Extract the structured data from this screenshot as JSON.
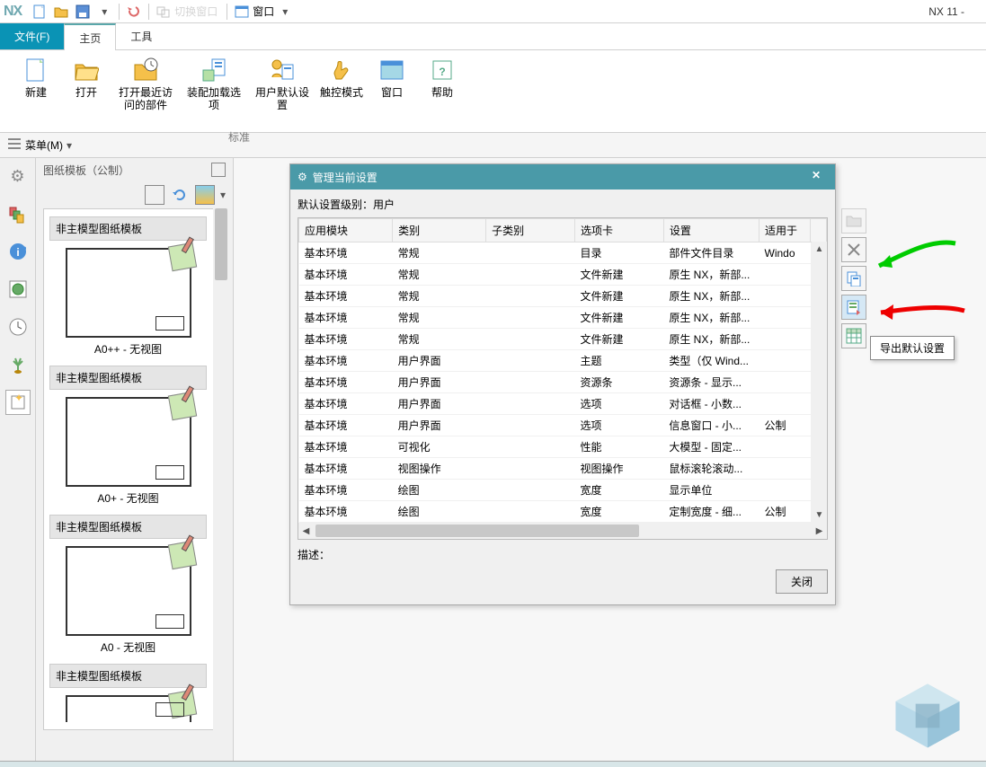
{
  "app": {
    "logo": "NX",
    "title": "NX 11 -"
  },
  "quickaccess": {
    "switch_window": "切换窗口",
    "window": "窗口"
  },
  "menu": {
    "file": "文件(F)",
    "home": "主页",
    "tools": "工具"
  },
  "ribbon": {
    "group_label": "标准",
    "new": "新建",
    "open": "打开",
    "open_recent": "打开最近访问的部件",
    "assy_load": "装配加载选项",
    "user_defaults": "用户默认设置",
    "touch_mode": "触控模式",
    "window": "窗口",
    "help": "帮助"
  },
  "menubar2": {
    "menu": "菜单(M)"
  },
  "template_panel": {
    "title": "图纸模板（公制）",
    "groups": [
      {
        "head": "非主模型图纸模板",
        "label": "A0++ - 无视图"
      },
      {
        "head": "非主模型图纸模板",
        "label": "A0+ - 无视图"
      },
      {
        "head": "非主模型图纸模板",
        "label": "A0 - 无视图"
      },
      {
        "head": "非主模型图纸模板",
        "label": ""
      }
    ]
  },
  "dialog": {
    "title": "管理当前设置",
    "level_label": "默认设置级别：用户",
    "columns": [
      "应用模块",
      "类别",
      "子类别",
      "选项卡",
      "设置",
      "适用于"
    ],
    "rows": [
      [
        "基本环境",
        "常规",
        "",
        "目录",
        "部件文件目录",
        "Windo"
      ],
      [
        "基本环境",
        "常规",
        "",
        "文件新建",
        "原生 NX，新部...",
        ""
      ],
      [
        "基本环境",
        "常规",
        "",
        "文件新建",
        "原生 NX，新部...",
        ""
      ],
      [
        "基本环境",
        "常规",
        "",
        "文件新建",
        "原生 NX，新部...",
        ""
      ],
      [
        "基本环境",
        "常规",
        "",
        "文件新建",
        "原生 NX，新部...",
        ""
      ],
      [
        "基本环境",
        "用户界面",
        "",
        "主题",
        "类型（仅 Wind...",
        ""
      ],
      [
        "基本环境",
        "用户界面",
        "",
        "资源条",
        "资源条 - 显示...",
        ""
      ],
      [
        "基本环境",
        "用户界面",
        "",
        "选项",
        "对话框 - 小数...",
        ""
      ],
      [
        "基本环境",
        "用户界面",
        "",
        "选项",
        "信息窗口 - 小...",
        "公制"
      ],
      [
        "基本环境",
        "可视化",
        "",
        "性能",
        "大模型 - 固定...",
        ""
      ],
      [
        "基本环境",
        "视图操作",
        "",
        "视图操作",
        "鼠标滚轮滚动...",
        ""
      ],
      [
        "基本环境",
        "绘图",
        "",
        "宽度",
        "显示单位",
        ""
      ],
      [
        "基本环境",
        "绘图",
        "",
        "宽度",
        "定制宽度 - 细...",
        "公制"
      ]
    ],
    "desc_label": "描述：",
    "close": "关闭"
  },
  "tooltip": "导出默认设置",
  "side_buttons": {
    "b1": "folder",
    "b2": "delete",
    "b3": "copy-defaults",
    "b4": "export-defaults",
    "b5": "spreadsheet"
  }
}
